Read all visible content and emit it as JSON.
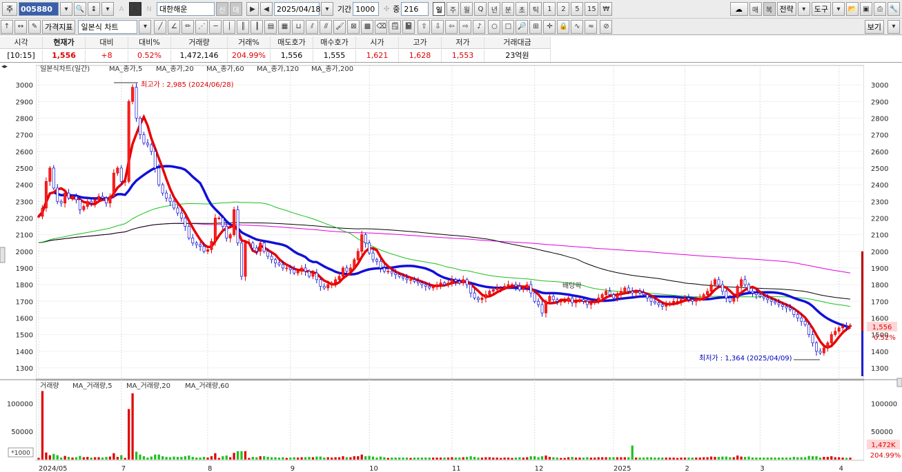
{
  "toolbar1": {
    "type_label": "주",
    "code": "005880",
    "k_label": "K",
    "n_label": "N",
    "a_label": "A",
    "stock_name": "대한해운",
    "sin_label": "신",
    "dae_label": "대",
    "date": "2025/04/18",
    "period_label": "기간",
    "period_value": "1000",
    "jung_label": "중",
    "jung_value": "216",
    "periods": [
      "일",
      "주",
      "월",
      "Q",
      "년",
      "분",
      "초",
      "틱",
      "1",
      "2",
      "5",
      "15"
    ],
    "maebok": [
      "매",
      "복"
    ],
    "strategy_label": "전략",
    "tools_label": "도구"
  },
  "toolbar2": {
    "price_indicator_label": "가격지표",
    "chart_type": "일본식 차트",
    "view_label": "보기"
  },
  "quote": {
    "headers": [
      "시각",
      "현재가",
      "대비",
      "대비%",
      "거래량",
      "거래%",
      "매도호가",
      "매수호가",
      "시가",
      "고가",
      "저가",
      "거래대금"
    ],
    "time": "[10:15]",
    "price": "1,556",
    "change": "+8",
    "change_pct": "0.52%",
    "volume": "1,472,146",
    "volume_pct": "204.99%",
    "ask": "1,556",
    "bid": "1,555",
    "open": "1,621",
    "high": "1,628",
    "low": "1,553",
    "amount": "23억원"
  },
  "chart_data": {
    "type": "candlestick",
    "price_legend": [
      "일본식차트(일간)",
      "MA_종가,5",
      "MA_종가,20",
      "MA_종가,60",
      "MA_종가,120",
      "MA_종가,200"
    ],
    "volume_legend": [
      "거래량",
      "MA_거래량,5",
      "MA_거래량,20",
      "MA_거래량,60"
    ],
    "price_ylim": [
      1250,
      3050
    ],
    "price_ticks": [
      1300,
      1400,
      1500,
      1600,
      1700,
      1800,
      1900,
      2000,
      2100,
      2200,
      2300,
      2400,
      2500,
      2600,
      2700,
      2800,
      2900,
      3000
    ],
    "volume_ylim": [
      0,
      130000
    ],
    "volume_ticks_left": [
      "100000",
      "50000"
    ],
    "volume_ticks_right": [
      "100000",
      "50000"
    ],
    "volume_unit": "*1000",
    "x_labels": [
      "2024/05",
      "7",
      "8",
      "9",
      "10",
      "11",
      "12",
      "2025",
      "2",
      "3",
      "4"
    ],
    "annotations": {
      "high": "최고가 : 2,985 (2024/06/28)",
      "low": "최저가 : 1,364 (2025/04/09)",
      "dividend": "배당락"
    },
    "current_price_tag": "1,556",
    "current_pct_tag": "0.52%",
    "volume_tag": "1,472K",
    "volume_pct_tag": "204.99%",
    "close_series": [
      2210,
      2260,
      2420,
      2500,
      2380,
      2300,
      2290,
      2350,
      2320,
      2330,
      2310,
      2250,
      2270,
      2300,
      2290,
      2310,
      2330,
      2320,
      2290,
      2330,
      2470,
      2500,
      2420,
      2420,
      2900,
      2985,
      2800,
      2700,
      2650,
      2640,
      2600,
      2500,
      2400,
      2350,
      2320,
      2300,
      2260,
      2230,
      2200,
      2150,
      2080,
      2050,
      2040,
      2030,
      2000,
      2010,
      2060,
      2200,
      2200,
      2150,
      2080,
      2100,
      2250,
      2050,
      1850,
      2050,
      2050,
      2020,
      2000,
      2050,
      2000,
      1970,
      1950,
      1930,
      1920,
      1900,
      1900,
      1890,
      1870,
      1880,
      1900,
      1880,
      1850,
      1870,
      1830,
      1790,
      1780,
      1800,
      1810,
      1830,
      1850,
      1900,
      1880,
      1900,
      1950,
      2000,
      2100,
      2050,
      1990,
      1950,
      1940,
      1900,
      1880,
      1880,
      1870,
      1860,
      1850,
      1840,
      1830,
      1830,
      1820,
      1810,
      1800,
      1790,
      1780,
      1790,
      1800,
      1810,
      1800,
      1810,
      1830,
      1820,
      1810,
      1830,
      1800,
      1750,
      1720,
      1710,
      1720,
      1740,
      1760,
      1770,
      1780,
      1780,
      1790,
      1800,
      1800,
      1790,
      1770,
      1780,
      1800,
      1750,
      1700,
      1680,
      1630,
      1700,
      1730,
      1710,
      1700,
      1700,
      1700,
      1720,
      1690,
      1700,
      1710,
      1700,
      1680,
      1690,
      1700,
      1720,
      1740,
      1760,
      1740,
      1720,
      1740,
      1760,
      1780,
      1760,
      1750,
      1760,
      1750,
      1740,
      1720,
      1700,
      1690,
      1680,
      1670,
      1680,
      1690,
      1700,
      1700,
      1710,
      1720,
      1710,
      1700,
      1710,
      1720,
      1740,
      1760,
      1800,
      1830,
      1800,
      1760,
      1720,
      1700,
      1720,
      1790,
      1830,
      1800,
      1760,
      1750,
      1740,
      1730,
      1720,
      1710,
      1700,
      1690,
      1680,
      1670,
      1660,
      1650,
      1620,
      1600,
      1580,
      1560,
      1500,
      1450,
      1400,
      1390,
      1420,
      1450,
      1500,
      1520,
      1540,
      1550,
      1548,
      1556
    ]
  }
}
